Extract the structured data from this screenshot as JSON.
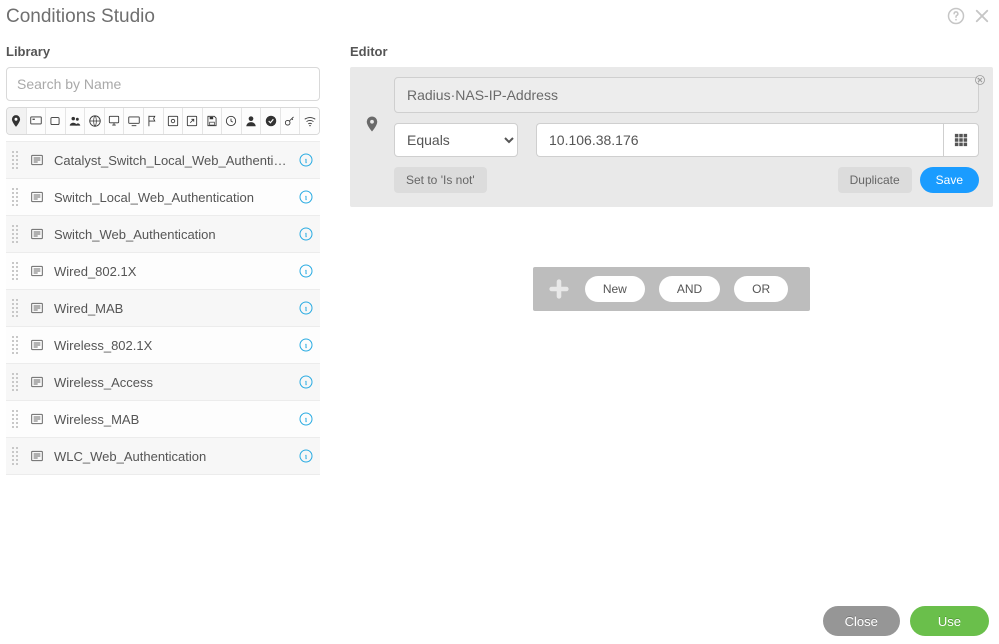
{
  "title": "Conditions Studio",
  "library": {
    "heading": "Library",
    "search_placeholder": "Search by Name",
    "items": [
      "Catalyst_Switch_Local_Web_Authentication",
      "Switch_Local_Web_Authentication",
      "Switch_Web_Authentication",
      "Wired_802.1X",
      "Wired_MAB",
      "Wireless_802.1X",
      "Wireless_Access",
      "Wireless_MAB",
      "WLC_Web_Authentication"
    ]
  },
  "editor": {
    "heading": "Editor",
    "attribute": "Radius·NAS-IP-Address",
    "operator": "Equals",
    "value": "10.106.38.176",
    "set_is_not": "Set to 'Is not'",
    "duplicate": "Duplicate",
    "save": "Save",
    "combine": {
      "new": "New",
      "and": "AND",
      "or": "OR"
    }
  },
  "footer": {
    "close": "Close",
    "use": "Use"
  }
}
